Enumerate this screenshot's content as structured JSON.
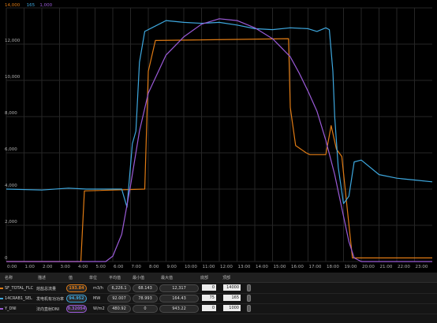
{
  "legend": [
    {
      "label": "14,000",
      "color": "#e07b14"
    },
    {
      "label": "165",
      "color": "#3ea8df"
    },
    {
      "label": "1,000",
      "color": "#9b5bd8"
    }
  ],
  "chart_data": {
    "type": "line",
    "x_ticks": [
      "0:00",
      "1:00",
      "2:00",
      "3:00",
      "4:00",
      "5:00",
      "6:00",
      "7:00",
      "8:00",
      "9:00",
      "10:00",
      "11:00",
      "12:00",
      "13:00",
      "14:00",
      "15:00",
      "16:00",
      "17:00",
      "18:00",
      "19:00",
      "20:00",
      "21:00",
      "22:00",
      "23:00"
    ],
    "xlim": [
      0,
      24
    ],
    "y_ticks": [
      "14,000",
      "12,000",
      "10,000",
      "8,000",
      "6,000",
      "4,000",
      "2,000",
      "0"
    ],
    "ylim": [
      0,
      14000
    ],
    "series": [
      {
        "name": "SF_TOTAL_FLOW",
        "color": "#e07b14",
        "x": [
          0,
          4.2,
          4.4,
          7.8,
          8.0,
          8.4,
          15.9,
          16.0,
          16.3,
          16.9,
          17.1,
          18.0,
          18.3,
          18.6,
          18.9,
          19.2,
          19.5,
          20.0,
          24
        ],
        "y": [
          0,
          0,
          3900,
          4000,
          10500,
          12200,
          12300,
          8500,
          6400,
          6000,
          5900,
          5900,
          7500,
          6200,
          5800,
          3000,
          200,
          200,
          200
        ]
      },
      {
        "name": "14CRAB1_SEL",
        "color": "#3ea8df",
        "x": [
          0,
          2,
          3.5,
          4.5,
          6.5,
          6.8,
          7.1,
          7.3,
          7.5,
          7.8,
          8.2,
          9,
          10,
          11,
          12,
          13,
          14,
          15,
          16,
          17,
          17.5,
          18,
          18.2,
          18.4,
          18.5,
          18.7,
          19.0,
          19.3,
          19.6,
          20,
          21,
          22,
          23,
          24
        ],
        "y": [
          4000,
          3950,
          4050,
          4000,
          4000,
          3000,
          6500,
          7200,
          11000,
          12700,
          12900,
          13300,
          13200,
          13150,
          13200,
          13050,
          12850,
          12800,
          12900,
          12850,
          12700,
          12900,
          12800,
          10500,
          8000,
          5200,
          3200,
          3600,
          5500,
          5600,
          4800,
          4600,
          4500,
          4400
        ]
      },
      {
        "name": "Y_DNI",
        "color": "#9b5bd8",
        "x": [
          0,
          5.6,
          6,
          6.5,
          7,
          7.5,
          8,
          9,
          10,
          11,
          12,
          13,
          14,
          15,
          16,
          16.5,
          17,
          17.5,
          18,
          18.5,
          19,
          19.3,
          19.6,
          20,
          24
        ],
        "y": [
          0,
          0,
          300,
          1500,
          4200,
          7200,
          9300,
          11400,
          12400,
          13100,
          13400,
          13300,
          12900,
          12300,
          11300,
          10400,
          9400,
          8300,
          6700,
          4800,
          2500,
          1100,
          200,
          0,
          0
        ]
      }
    ]
  },
  "table": {
    "headers": [
      "名称",
      "描述",
      "值",
      "单位",
      "平均值",
      "最小值",
      "最大值",
      "底部",
      "顶部"
    ],
    "rows": [
      {
        "name": "SF_TOTAL_FLC",
        "desc": "熔盐总流量",
        "value": "193.84",
        "unit": "m3/h",
        "avg": "6,226.1",
        "min": "68.143",
        "max": "12,317",
        "bottom": "0",
        "top": "14000",
        "color": "#e07b14"
      },
      {
        "name": "14CRAB1_SEL",
        "desc": "发电机有功功率",
        "value": "94.952",
        "unit": "MW",
        "avg": "92.007",
        "min": "78.993",
        "max": "164.43",
        "bottom": "75",
        "top": "165",
        "color": "#3ea8df"
      },
      {
        "name": "Y_DNI",
        "desc": "法向直射DNI",
        "value": "0.32054",
        "unit": "W/m2",
        "avg": "480.92",
        "min": "0",
        "max": "943.22",
        "bottom": "0",
        "top": "1000",
        "color": "#9b5bd8"
      }
    ]
  }
}
